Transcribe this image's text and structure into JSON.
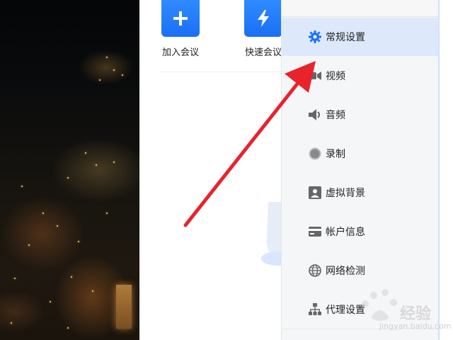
{
  "actions": [
    {
      "label": "加入会议",
      "icon": "plus-icon"
    },
    {
      "label": "快速会议",
      "icon": "lightning-icon"
    }
  ],
  "menu": {
    "items": [
      {
        "label": "常规设置",
        "icon": "gear-icon",
        "active": true
      },
      {
        "label": "视频",
        "icon": "camera-icon"
      },
      {
        "label": "音频",
        "icon": "speaker-icon"
      },
      {
        "label": "录制",
        "icon": "record-icon"
      },
      {
        "label": "虚拟背景",
        "icon": "portrait-icon"
      },
      {
        "label": "帐户信息",
        "icon": "card-icon"
      },
      {
        "label": "网络检测",
        "icon": "globe-icon"
      },
      {
        "label": "代理设置",
        "icon": "network-icon"
      }
    ]
  },
  "watermark": {
    "text": "经验",
    "url": "jingyan.baidu.com"
  },
  "colors": {
    "accent": "#1a73f5",
    "annotation": "#e8232b",
    "active_bg": "#dde9fb"
  }
}
